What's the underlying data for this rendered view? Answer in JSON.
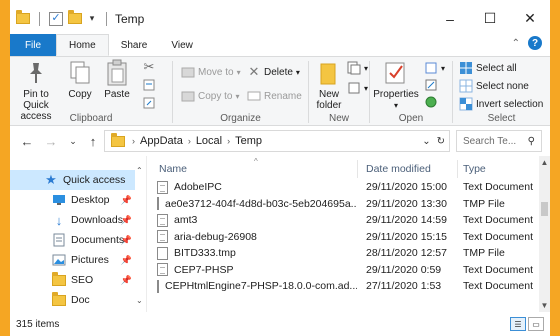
{
  "window": {
    "title": "Temp",
    "buttons": {
      "minimize": "–",
      "maximize": "☐",
      "close": "✕"
    }
  },
  "tabs": [
    "File",
    "Home",
    "Share",
    "View"
  ],
  "ribbon": {
    "clipboard": {
      "label": "Clipboard",
      "pin": "Pin to Quick access",
      "copy": "Copy",
      "paste": "Paste"
    },
    "organize": {
      "label": "Organize",
      "move_to": "Move to",
      "copy_to": "Copy to",
      "delete": "Delete",
      "rename": "Rename"
    },
    "new": {
      "label": "New",
      "new_folder": "New folder"
    },
    "open": {
      "label": "Open",
      "properties": "Properties"
    },
    "select": {
      "label": "Select",
      "select_all": "Select all",
      "select_none": "Select none",
      "invert": "Invert selection"
    }
  },
  "address": {
    "crumbs": [
      "AppData",
      "Local",
      "Temp"
    ],
    "search_placeholder": "Search Te..."
  },
  "nav": [
    {
      "label": "Quick access",
      "icon": "star-icon",
      "pinned": false
    },
    {
      "label": "Desktop",
      "icon": "desktop-icon",
      "pinned": true
    },
    {
      "label": "Downloads",
      "icon": "download-icon",
      "pinned": true
    },
    {
      "label": "Documents",
      "icon": "documents-icon",
      "pinned": true
    },
    {
      "label": "Pictures",
      "icon": "pictures-icon",
      "pinned": true
    },
    {
      "label": "SEO",
      "icon": "folder-icon",
      "pinned": true
    },
    {
      "label": "Doc",
      "icon": "folder-icon",
      "pinned": false
    }
  ],
  "columns": {
    "name": "Name",
    "date": "Date modified",
    "type": "Type"
  },
  "files": [
    {
      "name": "AdobeIPC",
      "date": "29/11/2020 15:00",
      "type": "Text Document"
    },
    {
      "name": "ae0e3712-404f-4d8d-b03c-5eb204695a...",
      "date": "29/11/2020 13:30",
      "type": "TMP File"
    },
    {
      "name": "amt3",
      "date": "29/11/2020 14:59",
      "type": "Text Document"
    },
    {
      "name": "aria-debug-26908",
      "date": "29/11/2020 15:15",
      "type": "Text Document"
    },
    {
      "name": "BITD333.tmp",
      "date": "28/11/2020 12:57",
      "type": "TMP File"
    },
    {
      "name": "CEP7-PHSP",
      "date": "29/11/2020 0:59",
      "type": "Text Document"
    },
    {
      "name": "CEPHtmlEngine7-PHSP-18.0.0-com.ad...",
      "date": "27/11/2020 1:53",
      "type": "Text Document"
    }
  ],
  "status": {
    "items": "315 items"
  }
}
